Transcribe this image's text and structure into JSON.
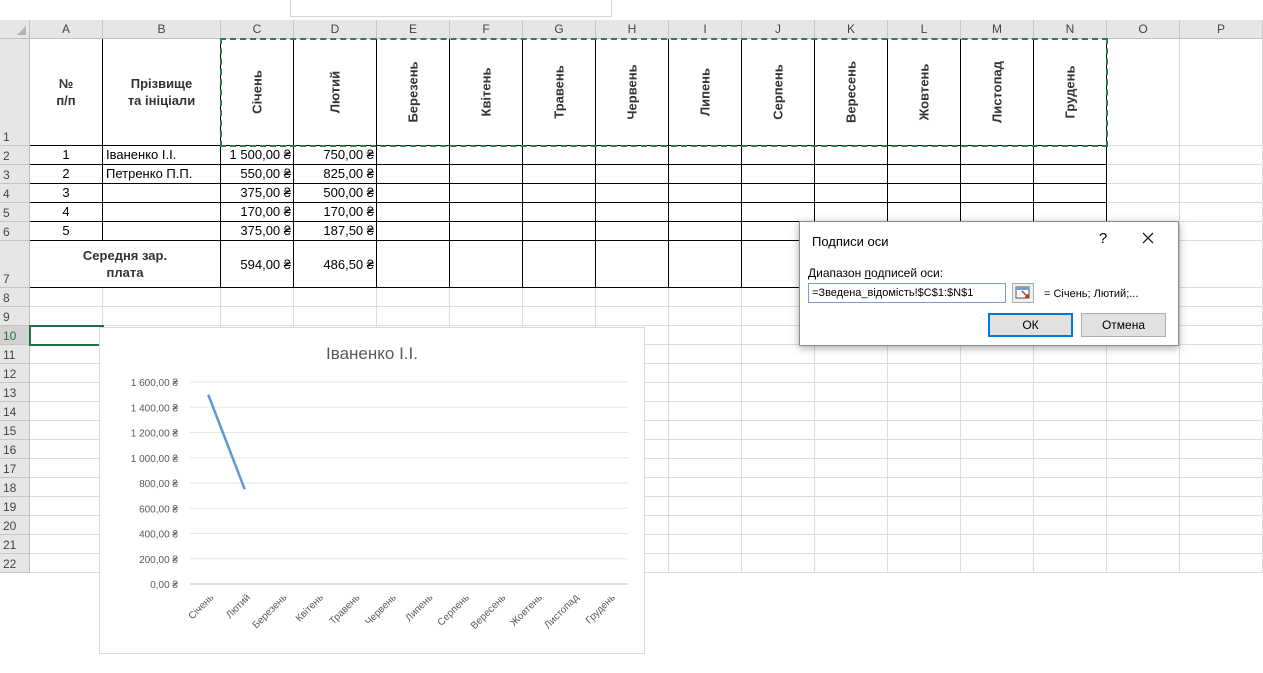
{
  "columns": [
    "A",
    "B",
    "C",
    "D",
    "E",
    "F",
    "G",
    "H",
    "I",
    "J",
    "K",
    "L",
    "M",
    "N",
    "O",
    "P"
  ],
  "rows": [
    "1",
    "2",
    "3",
    "4",
    "5",
    "6",
    "7",
    "8",
    "9",
    "10",
    "11",
    "12",
    "13",
    "14",
    "15",
    "16",
    "17",
    "18",
    "19",
    "20",
    "21",
    "22"
  ],
  "header": {
    "num": "№\nп/п",
    "name": "Прізвище\nта ініціали",
    "months": [
      "Січень",
      "Лютий",
      "Березень",
      "Квітень",
      "Травень",
      "Червень",
      "Липень",
      "Серпень",
      "Вересень",
      "Жовтень",
      "Листопад",
      "Грудень"
    ]
  },
  "table_rows": [
    {
      "n": "1",
      "name": "Іваненко І.І.",
      "jan": "1 500,00 ₴",
      "feb": "750,00 ₴"
    },
    {
      "n": "2",
      "name": "Петренко П.П.",
      "jan": "550,00 ₴",
      "feb": "825,00 ₴"
    },
    {
      "n": "3",
      "name": "",
      "jan": "375,00 ₴",
      "feb": "500,00 ₴"
    },
    {
      "n": "4",
      "name": "",
      "jan": "170,00 ₴",
      "feb": "170,00 ₴"
    },
    {
      "n": "5",
      "name": "",
      "jan": "375,00 ₴",
      "feb": "187,50 ₴"
    }
  ],
  "average": {
    "label": "Середня зар.\nплата",
    "jan": "594,00 ₴",
    "feb": "486,50 ₴"
  },
  "chart_data": {
    "type": "line",
    "title": "Іваненко І.І.",
    "categories": [
      "Січень",
      "Лютий",
      "Березень",
      "Квітень",
      "Травень",
      "Червень",
      "Липень",
      "Серпень",
      "Вересень",
      "Жовтень",
      "Листопад",
      "Грудень"
    ],
    "series": [
      {
        "values": [
          1500,
          750
        ]
      }
    ],
    "yticks": [
      "1 600,00 ₴",
      "1 400,00 ₴",
      "1 200,00 ₴",
      "1 000,00 ₴",
      "800,00 ₴",
      "600,00 ₴",
      "400,00 ₴",
      "200,00 ₴",
      "0,00 ₴"
    ],
    "ylim": [
      0,
      1600
    ],
    "grid": true,
    "line_color": "#5b9bd5"
  },
  "dialog": {
    "title": "Подписи оси",
    "help": "?",
    "label_pre": "Диапазон ",
    "label_u": "п",
    "label_post": "одписей оси:",
    "input_value": "=Зведена_відомість!$C$1:$N$1",
    "preview": "= Січень; Лютий;...",
    "ok": "ОК",
    "cancel": "Отмена"
  }
}
